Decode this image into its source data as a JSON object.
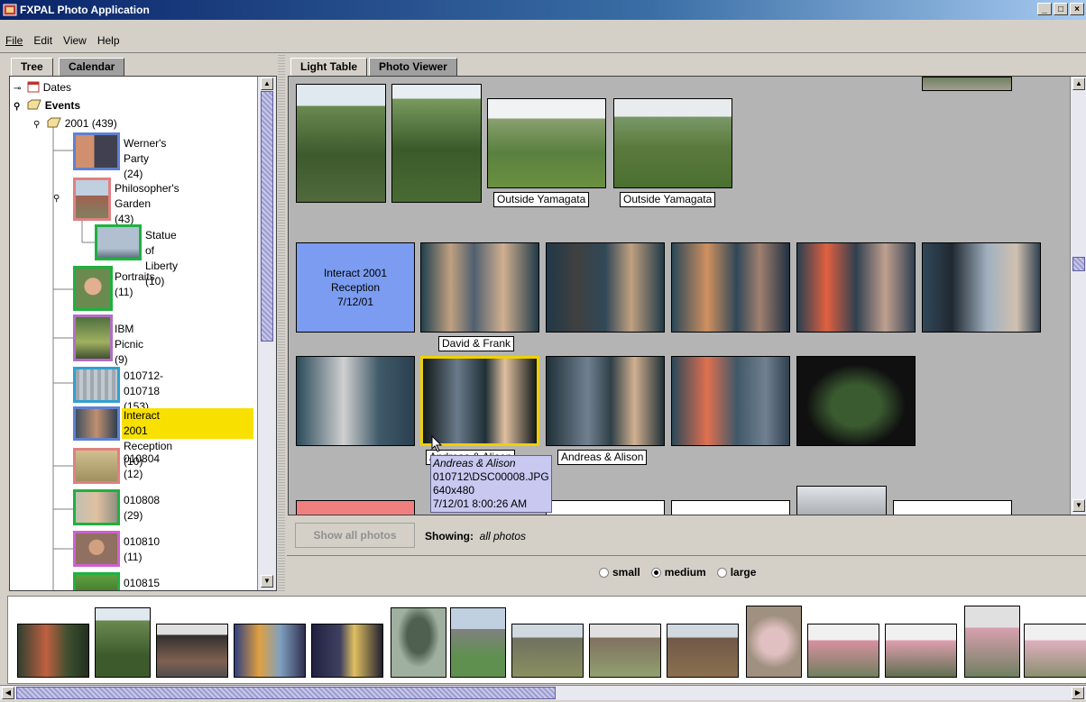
{
  "window": {
    "title": "FXPAL Photo Application",
    "buttons": [
      "_",
      "□",
      "×"
    ]
  },
  "menu": [
    {
      "label": "File"
    },
    {
      "label": "Edit"
    },
    {
      "label": "View"
    },
    {
      "label": "Help"
    }
  ],
  "left_tabs": [
    "Tree",
    "Calendar"
  ],
  "right_tabs": [
    "Light Table",
    "Photo Viewer"
  ],
  "tree": {
    "dates": "Dates",
    "events": "Events",
    "year": "2001 (439)",
    "nodes": [
      {
        "name": "Werner's Party",
        "count": "(24)",
        "color": "#6080d0"
      },
      {
        "name": "Philosopher's Garden",
        "count": "(43)",
        "color": "#e08080"
      },
      {
        "name": "Statue of Liberty",
        "count": "(10)",
        "color": "#20b040"
      },
      {
        "name": "Portraits",
        "count": "(11)",
        "color": "#20b040"
      },
      {
        "name": "IBM Picnic",
        "count": "(9)",
        "color": "#b070c0"
      },
      {
        "name": "010712-010718",
        "count": "(153)",
        "color": "#30a0d0"
      },
      {
        "name": "Interact 2001 Reception",
        "count": "(10)",
        "color": "#6080d0"
      },
      {
        "name": "010804",
        "count": "(12)",
        "color": "#e08080"
      },
      {
        "name": "010808",
        "count": "(29)",
        "color": "#20b040"
      },
      {
        "name": "010810",
        "count": "(11)",
        "color": "#d060d0"
      },
      {
        "name": "010815",
        "count": "",
        "color": "#20b040"
      }
    ]
  },
  "light_table": {
    "captions": [
      "Outside Yamagata",
      "Outside Yamagata",
      "David & Frank",
      "Andreas & Alison",
      "Andreas & Alison"
    ],
    "group_label": [
      "Interact 2001",
      "Reception",
      "7/12/01"
    ],
    "tooltip": [
      "Andreas & Alison",
      "010712\\DSC00008.JPG",
      "640x480",
      "7/12/01 8:00:26 AM"
    ]
  },
  "controls": {
    "show_all": "Show all photos",
    "showing_label": "Showing:",
    "showing_value": "all photos",
    "sizes": [
      "small",
      "medium",
      "large"
    ],
    "selected_size": "medium"
  }
}
